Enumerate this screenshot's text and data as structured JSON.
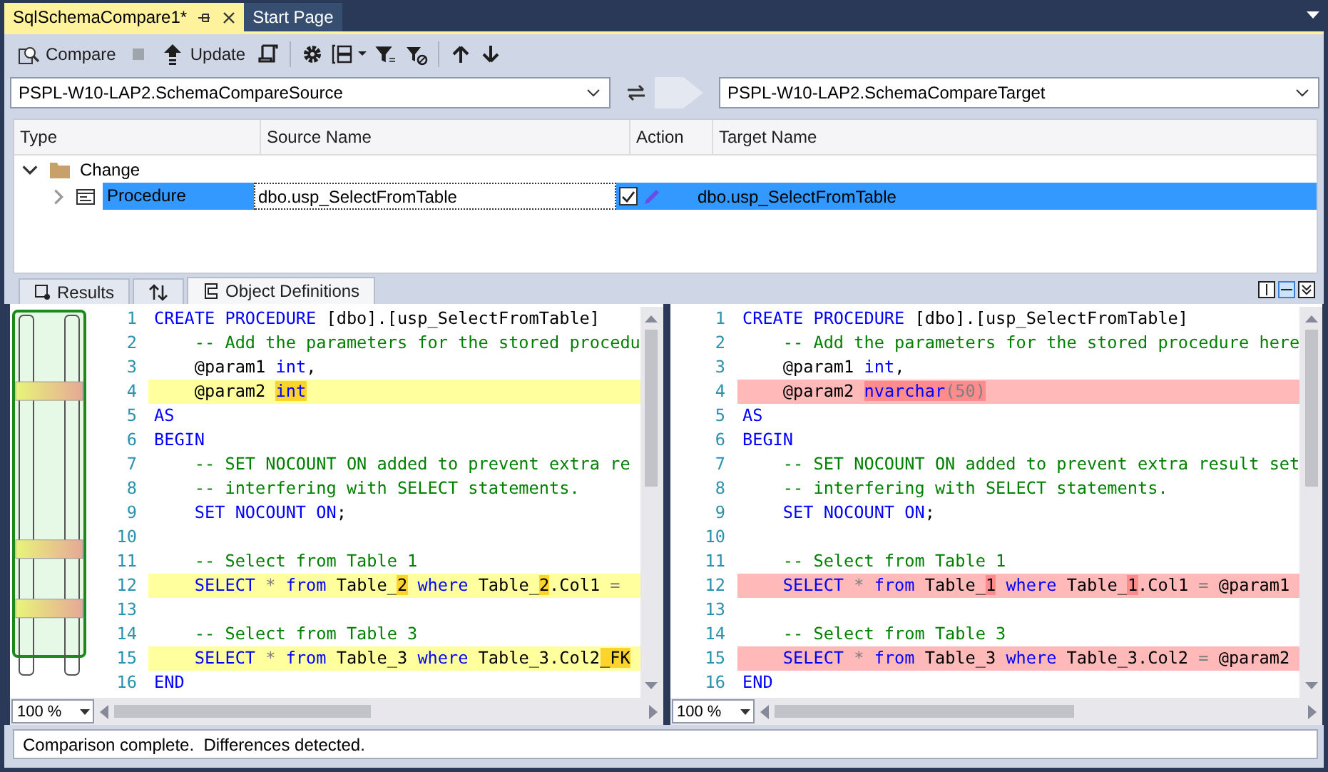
{
  "document_tabs": [
    {
      "label": "SqlSchemaCompare1*",
      "selected": true
    },
    {
      "label": "Start Page",
      "selected": false
    }
  ],
  "toolbar": {
    "compare_label": "Compare",
    "stop_disabled": true,
    "update_label": "Update"
  },
  "source": {
    "value": "PSPL-W10-LAP2.SchemaCompareSource"
  },
  "target": {
    "value": "PSPL-W10-LAP2.SchemaCompareTarget"
  },
  "grid": {
    "columns": [
      "Type",
      "Source Name",
      "Action",
      "Target Name"
    ],
    "groups": [
      {
        "label": "Change",
        "expanded": true,
        "rows": [
          {
            "type": "Procedure",
            "source_name": "dbo.usp_SelectFromTable",
            "include": true,
            "target_name": "dbo.usp_SelectFromTable",
            "selected": true,
            "expanded": false
          }
        ]
      }
    ]
  },
  "result_tabs": [
    {
      "kind": "results",
      "label": "Results",
      "selected": false
    },
    {
      "kind": "sort",
      "selected": false
    },
    {
      "kind": "definitions",
      "label": "Object Definitions",
      "selected": true
    }
  ],
  "panes": [
    {
      "kind": "source",
      "zoom": "100 %",
      "lines": [
        {
          "number": "1",
          "changed": false,
          "tokens": [
            {
              "text": "CREATE PROCEDURE",
              "kind": "keyword",
              "changed": false
            },
            {
              "text": " [dbo].[usp_SelectFromTable]",
              "kind": "plain",
              "changed": false
            }
          ]
        },
        {
          "number": "2",
          "changed": false,
          "tokens": [
            {
              "text": "    -- Add the parameters for the stored procedu",
              "kind": "comment",
              "changed": false
            }
          ]
        },
        {
          "number": "3",
          "changed": false,
          "tokens": [
            {
              "text": "    @param1",
              "kind": "plain",
              "changed": false
            },
            {
              "text": " int",
              "kind": "keyword",
              "changed": false
            },
            {
              "text": ",",
              "kind": "plain",
              "changed": false
            }
          ]
        },
        {
          "number": "4",
          "changed": true,
          "tokens": [
            {
              "text": "    @param2 ",
              "kind": "plain",
              "changed": false
            },
            {
              "text": "int",
              "kind": "keyword",
              "changed": true
            }
          ]
        },
        {
          "number": "5",
          "changed": false,
          "tokens": [
            {
              "text": "AS",
              "kind": "keyword",
              "changed": false
            }
          ]
        },
        {
          "number": "6",
          "changed": false,
          "tokens": [
            {
              "text": "BEGIN",
              "kind": "keyword",
              "changed": false
            }
          ]
        },
        {
          "number": "7",
          "changed": false,
          "tokens": [
            {
              "text": "    -- SET NOCOUNT ON added to prevent extra re",
              "kind": "comment",
              "changed": false
            }
          ]
        },
        {
          "number": "8",
          "changed": false,
          "tokens": [
            {
              "text": "    -- interfering with SELECT statements.",
              "kind": "comment",
              "changed": false
            }
          ]
        },
        {
          "number": "9",
          "changed": false,
          "tokens": [
            {
              "text": "    SET NOCOUNT ON",
              "kind": "keyword",
              "changed": false
            },
            {
              "text": ";",
              "kind": "plain",
              "changed": false
            }
          ]
        },
        {
          "number": "10",
          "changed": false
        },
        {
          "number": "11",
          "changed": false,
          "tokens": [
            {
              "text": "    -- Select from Table 1",
              "kind": "comment",
              "changed": false
            }
          ]
        },
        {
          "number": "12",
          "changed": true,
          "tokens": [
            {
              "text": "    SELECT",
              "kind": "keyword",
              "changed": false
            },
            {
              "text": " * ",
              "kind": "operator",
              "changed": false
            },
            {
              "text": "from",
              "kind": "keyword",
              "changed": false
            },
            {
              "text": " Table_",
              "kind": "plain",
              "changed": false
            },
            {
              "text": "2",
              "kind": "plain",
              "changed": true
            },
            {
              "text": " where",
              "kind": "keyword",
              "changed": false
            },
            {
              "text": " Table_",
              "kind": "plain",
              "changed": false
            },
            {
              "text": "2",
              "kind": "plain",
              "changed": true
            },
            {
              "text": ".Col1 ",
              "kind": "plain",
              "changed": false
            },
            {
              "text": "=",
              "kind": "operator",
              "changed": false
            }
          ]
        },
        {
          "number": "13",
          "changed": false
        },
        {
          "number": "14",
          "changed": false,
          "tokens": [
            {
              "text": "    -- Select from Table 3",
              "kind": "comment",
              "changed": false
            }
          ]
        },
        {
          "number": "15",
          "changed": true,
          "tokens": [
            {
              "text": "    SELECT",
              "kind": "keyword",
              "changed": false
            },
            {
              "text": " * ",
              "kind": "operator",
              "changed": false
            },
            {
              "text": "from",
              "kind": "keyword",
              "changed": false
            },
            {
              "text": " Table_3 ",
              "kind": "plain",
              "changed": false
            },
            {
              "text": "where",
              "kind": "keyword",
              "changed": false
            },
            {
              "text": " Table_3.Col2",
              "kind": "plain",
              "changed": false
            },
            {
              "text": "_FK",
              "kind": "plain",
              "changed": true
            }
          ]
        },
        {
          "number": "16",
          "changed": false,
          "tokens": [
            {
              "text": "END",
              "kind": "keyword",
              "changed": false
            }
          ]
        }
      ]
    },
    {
      "kind": "target",
      "zoom": "100 %",
      "lines": [
        {
          "number": "1",
          "changed": false,
          "tokens": [
            {
              "text": "CREATE PROCEDURE",
              "kind": "keyword",
              "changed": false
            },
            {
              "text": " [dbo].[usp_SelectFromTable]",
              "kind": "plain",
              "changed": false
            }
          ]
        },
        {
          "number": "2",
          "changed": false,
          "tokens": [
            {
              "text": "    -- Add the parameters for the stored procedure here",
              "kind": "comment",
              "changed": false
            }
          ]
        },
        {
          "number": "3",
          "changed": false,
          "tokens": [
            {
              "text": "    @param1",
              "kind": "plain",
              "changed": false
            },
            {
              "text": " int",
              "kind": "keyword",
              "changed": false
            },
            {
              "text": ",",
              "kind": "plain",
              "changed": false
            }
          ]
        },
        {
          "number": "4",
          "changed": true,
          "tokens": [
            {
              "text": "    @param2 ",
              "kind": "plain",
              "changed": false
            },
            {
              "text": "nvarchar",
              "kind": "keyword",
              "changed": true
            },
            {
              "text": "(50)",
              "kind": "operator",
              "changed": true
            }
          ]
        },
        {
          "number": "5",
          "changed": false,
          "tokens": [
            {
              "text": "AS",
              "kind": "keyword",
              "changed": false
            }
          ]
        },
        {
          "number": "6",
          "changed": false,
          "tokens": [
            {
              "text": "BEGIN",
              "kind": "keyword",
              "changed": false
            }
          ]
        },
        {
          "number": "7",
          "changed": false,
          "tokens": [
            {
              "text": "    -- SET NOCOUNT ON added to prevent extra result set",
              "kind": "comment",
              "changed": false
            }
          ]
        },
        {
          "number": "8",
          "changed": false,
          "tokens": [
            {
              "text": "    -- interfering with SELECT statements.",
              "kind": "comment",
              "changed": false
            }
          ]
        },
        {
          "number": "9",
          "changed": false,
          "tokens": [
            {
              "text": "    SET NOCOUNT ON",
              "kind": "keyword",
              "changed": false
            },
            {
              "text": ";",
              "kind": "plain",
              "changed": false
            }
          ]
        },
        {
          "number": "10",
          "changed": false
        },
        {
          "number": "11",
          "changed": false,
          "tokens": [
            {
              "text": "    -- Select from Table 1",
              "kind": "comment",
              "changed": false
            }
          ]
        },
        {
          "number": "12",
          "changed": true,
          "tokens": [
            {
              "text": "    SELECT",
              "kind": "keyword",
              "changed": false
            },
            {
              "text": " * ",
              "kind": "operator",
              "changed": false
            },
            {
              "text": "from",
              "kind": "keyword",
              "changed": false
            },
            {
              "text": " Table_",
              "kind": "plain",
              "changed": false
            },
            {
              "text": "1",
              "kind": "plain",
              "changed": true
            },
            {
              "text": " where",
              "kind": "keyword",
              "changed": false
            },
            {
              "text": " Table_",
              "kind": "plain",
              "changed": false
            },
            {
              "text": "1",
              "kind": "plain",
              "changed": true
            },
            {
              "text": ".Col1 ",
              "kind": "plain",
              "changed": false
            },
            {
              "text": "=",
              "kind": "operator",
              "changed": false
            },
            {
              "text": " @param1",
              "kind": "plain",
              "changed": false
            }
          ]
        },
        {
          "number": "13",
          "changed": false
        },
        {
          "number": "14",
          "changed": false,
          "tokens": [
            {
              "text": "    -- Select from Table 3",
              "kind": "comment",
              "changed": false
            }
          ]
        },
        {
          "number": "15",
          "changed": true,
          "tokens": [
            {
              "text": "    SELECT",
              "kind": "keyword",
              "changed": false
            },
            {
              "text": " * ",
              "kind": "operator",
              "changed": false
            },
            {
              "text": "from",
              "kind": "keyword",
              "changed": false
            },
            {
              "text": " Table_3 ",
              "kind": "plain",
              "changed": false
            },
            {
              "text": "where",
              "kind": "keyword",
              "changed": false
            },
            {
              "text": " Table_3.Col2 ",
              "kind": "plain",
              "changed": false
            },
            {
              "text": "=",
              "kind": "operator",
              "changed": false
            },
            {
              "text": " @param2",
              "kind": "plain",
              "changed": false
            }
          ]
        },
        {
          "number": "16",
          "changed": false,
          "tokens": [
            {
              "text": "END",
              "kind": "keyword",
              "changed": false
            }
          ]
        }
      ]
    }
  ],
  "status_bar": {
    "text": "Comparison complete.  Differences detected."
  }
}
